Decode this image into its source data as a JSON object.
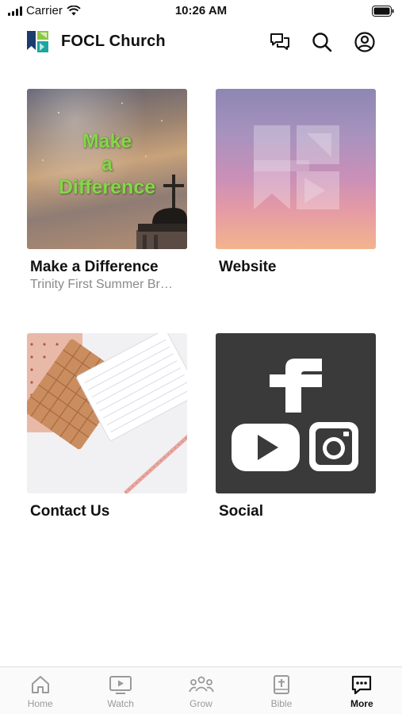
{
  "status_bar": {
    "carrier": "Carrier",
    "time": "10:26 AM"
  },
  "header": {
    "title": "FOCL Church",
    "icons": [
      "chat-icon",
      "search-icon",
      "profile-icon"
    ]
  },
  "tiles": [
    {
      "title": "Make a Difference",
      "subtitle": "Trinity First Summer Br…",
      "image_text": [
        "Make",
        "a",
        "Difference"
      ]
    },
    {
      "title": "Website"
    },
    {
      "title": "Contact Us"
    },
    {
      "title": "Social"
    }
  ],
  "tab_bar": {
    "tabs": [
      {
        "label": "Home",
        "icon": "home-icon"
      },
      {
        "label": "Watch",
        "icon": "tv-icon"
      },
      {
        "label": "Grow",
        "icon": "group-icon"
      },
      {
        "label": "Bible",
        "icon": "bible-icon"
      },
      {
        "label": "More",
        "icon": "more-chat-icon",
        "active": true
      }
    ]
  },
  "colors": {
    "accent": "#111111",
    "inactive": "#9a9a9a",
    "logo_teal": "#1aa6a0",
    "logo_navy": "#1c3c6e",
    "logo_green": "#8cc63f",
    "highlight_green": "#86d64a",
    "social_bg": "#3a3a3a"
  }
}
